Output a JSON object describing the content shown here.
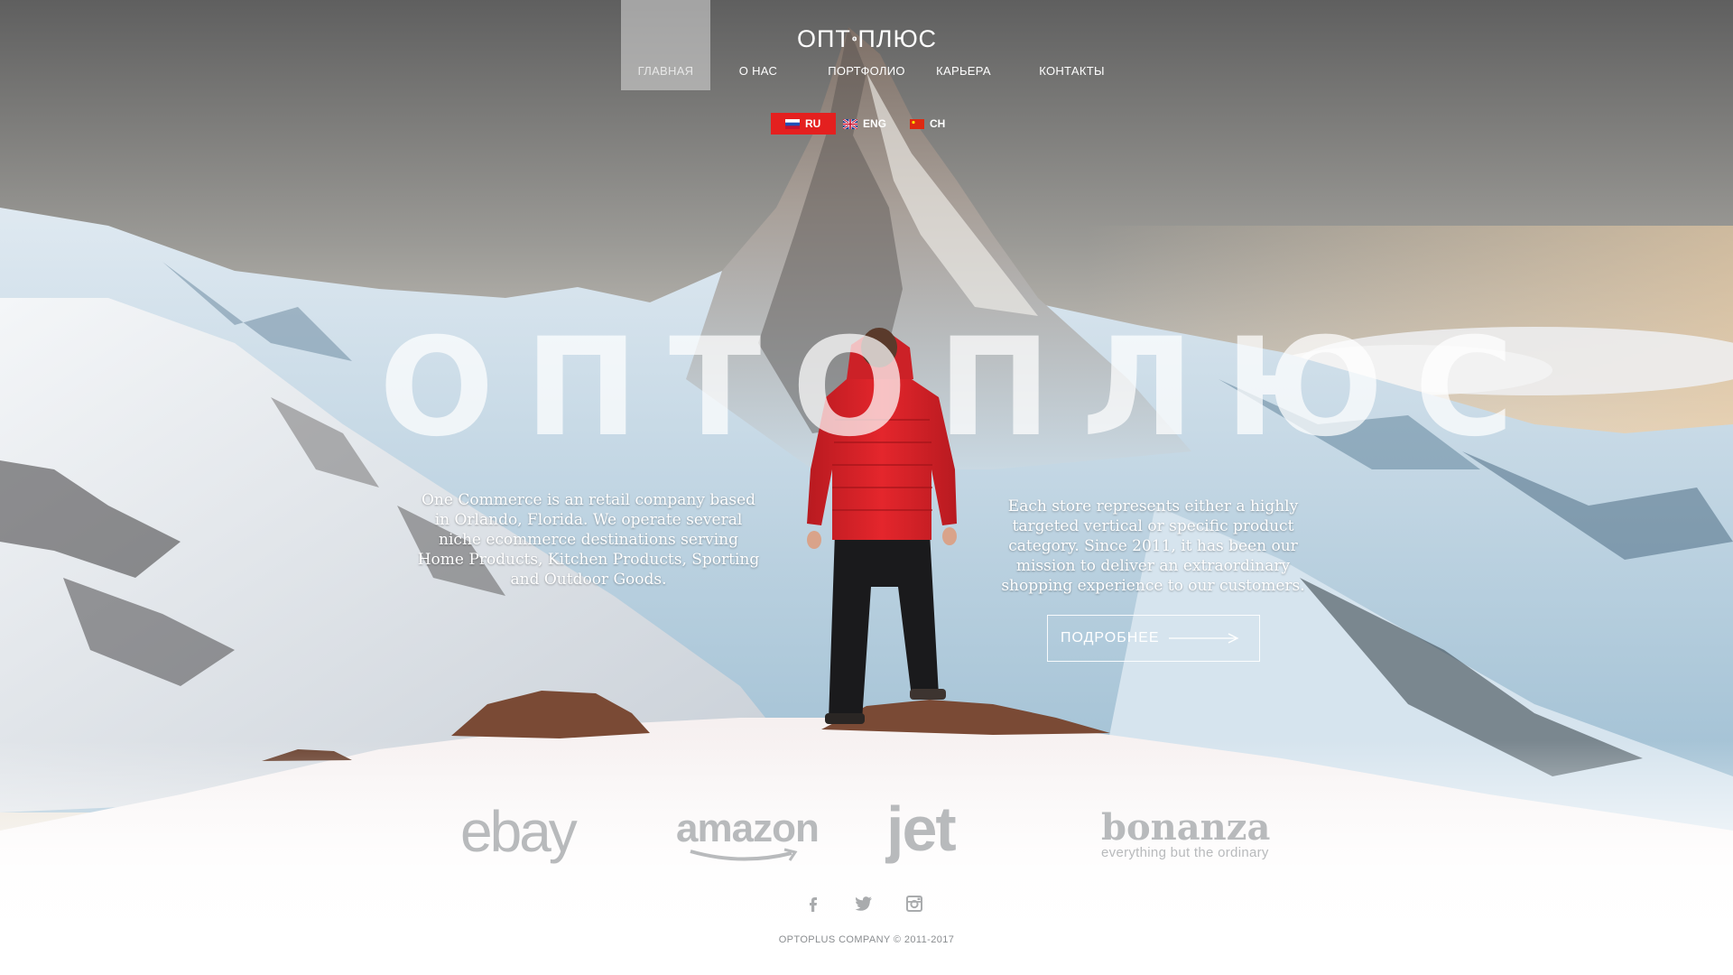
{
  "brand": {
    "logo_text_left": "ОПТ",
    "logo_text_right": "ПЛЮС"
  },
  "nav": {
    "items": [
      {
        "label": "ГЛАВНАЯ",
        "active": true
      },
      {
        "label": "О НАС",
        "active": false
      },
      {
        "label": "ПОРТФОЛИО",
        "active": false
      },
      {
        "label": "КАРЬЕРА",
        "active": false
      },
      {
        "label": "КОНТАКТЫ",
        "active": false
      }
    ]
  },
  "languages": [
    {
      "code": "RU",
      "active": true,
      "flag": "russia-flag-icon"
    },
    {
      "code": "ENG",
      "active": false,
      "flag": "uk-flag-icon"
    },
    {
      "code": "CH",
      "active": false,
      "flag": "china-flag-icon"
    }
  ],
  "hero": {
    "title": "ОПТОПЛЮС",
    "left_text": "One Commerce is an retail company based in Orlando, Florida. We operate several niche ecommerce destinations serving Home Products, Kitchen Products, Sporting and Outdoor Goods.",
    "right_text": "Each store represents either a highly targeted vertical or specific product category. Since 2011, it has been our mission to deliver an extraordinary shopping experience to our customers.",
    "more_button": "ПОДРОБНЕЕ"
  },
  "partners": {
    "ebay": "ebay",
    "amazon": "amazon",
    "jet": "jet",
    "bonanza": "bonanza",
    "bonanza_tagline": "everything but the ordinary"
  },
  "social": [
    "facebook-icon",
    "twitter-icon",
    "instagram-icon"
  ],
  "footer": {
    "copyright": "OPTOPLUS COMPANY © 2011-2017"
  },
  "colors": {
    "accent": "#e4201f",
    "jacket": "#d9262b",
    "sky_top": "#6e6e6e"
  }
}
